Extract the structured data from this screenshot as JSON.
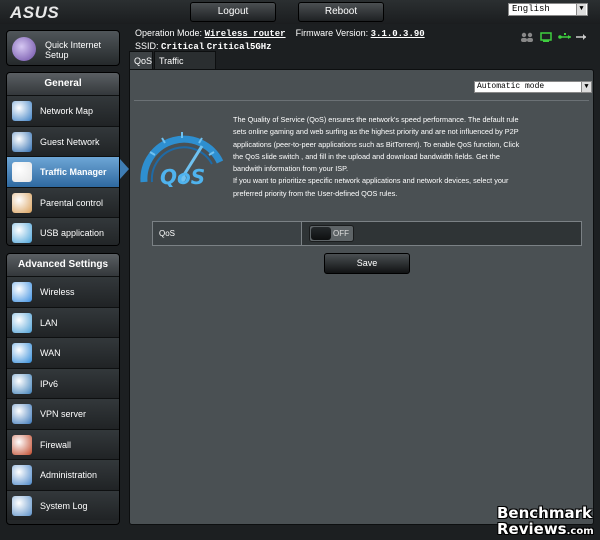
{
  "header": {
    "logo_text": "ASUS",
    "logout_label": "Logout",
    "reboot_label": "Reboot",
    "language": "English"
  },
  "quick_setup": {
    "label_line1": "Quick Internet",
    "label_line2": "Setup",
    "icon": "wand-icon"
  },
  "nav": {
    "general": {
      "title": "General",
      "items": [
        {
          "label": "Network Map",
          "icon": "network-map-icon",
          "color": "#3b7fc4"
        },
        {
          "label": "Guest Network",
          "icon": "guest-network-icon",
          "color": "#2d6cb0"
        },
        {
          "label": "Traffic Manager",
          "icon": "traffic-manager-icon",
          "color": "#e6e6e6",
          "active": true
        },
        {
          "label": "Parental control",
          "icon": "parental-control-icon",
          "color": "#d9a05b"
        },
        {
          "label": "USB application",
          "icon": "usb-application-icon",
          "color": "#4aa3d9"
        }
      ]
    },
    "advanced": {
      "title": "Advanced Settings",
      "items": [
        {
          "label": "Wireless",
          "icon": "wireless-icon",
          "color": "#3a8ee0"
        },
        {
          "label": "LAN",
          "icon": "lan-icon",
          "color": "#4b9fd6"
        },
        {
          "label": "WAN",
          "icon": "wan-icon",
          "color": "#2f8ad8"
        },
        {
          "label": "IPv6",
          "icon": "ipv6-icon",
          "color": "#3d7fb8"
        },
        {
          "label": "VPN server",
          "icon": "vpn-server-icon",
          "color": "#3a76b8"
        },
        {
          "label": "Firewall",
          "icon": "firewall-icon",
          "color": "#c0492b"
        },
        {
          "label": "Administration",
          "icon": "administration-icon",
          "color": "#4a86c8"
        },
        {
          "label": "System Log",
          "icon": "system-log-icon",
          "color": "#5a8fc7"
        }
      ]
    }
  },
  "status": {
    "operation_mode_label": "Operation Mode:",
    "operation_mode_value": "Wireless router",
    "firmware_label": "Firmware Version:",
    "firmware_value": "3.1.0.3.90",
    "ssid_label": "SSID:",
    "ssid_value_1": "Critical",
    "ssid_value_2": "Critical5GHz"
  },
  "tabs": [
    {
      "label": "QoS"
    },
    {
      "label": "Traffic Monitor"
    }
  ],
  "main": {
    "mode_select": "Automatic mode",
    "qos_logo_text": "QoS",
    "description": [
      "The Quality of Service (QoS) ensures the network's speed performance. The default rule",
      "sets online gaming and web surfing as the highest priority and are not influenced by P2P",
      "applications (peer-to-peer applications such as BitTorrent). To enable QoS function, Click",
      "the QoS slide switch , and fill in the upload and download bandwidth fields. Get the",
      "bandwith information from your ISP.",
      "If you want to prioritize specific network applications and network devices, select your",
      "preferred priority from the User-defined QOS rules."
    ],
    "qos_label": "QoS",
    "qos_toggle_state": "OFF",
    "save_label": "Save"
  },
  "watermark": {
    "line1": "Benchmark",
    "line2": "Reviews",
    "suffix": ".com"
  }
}
